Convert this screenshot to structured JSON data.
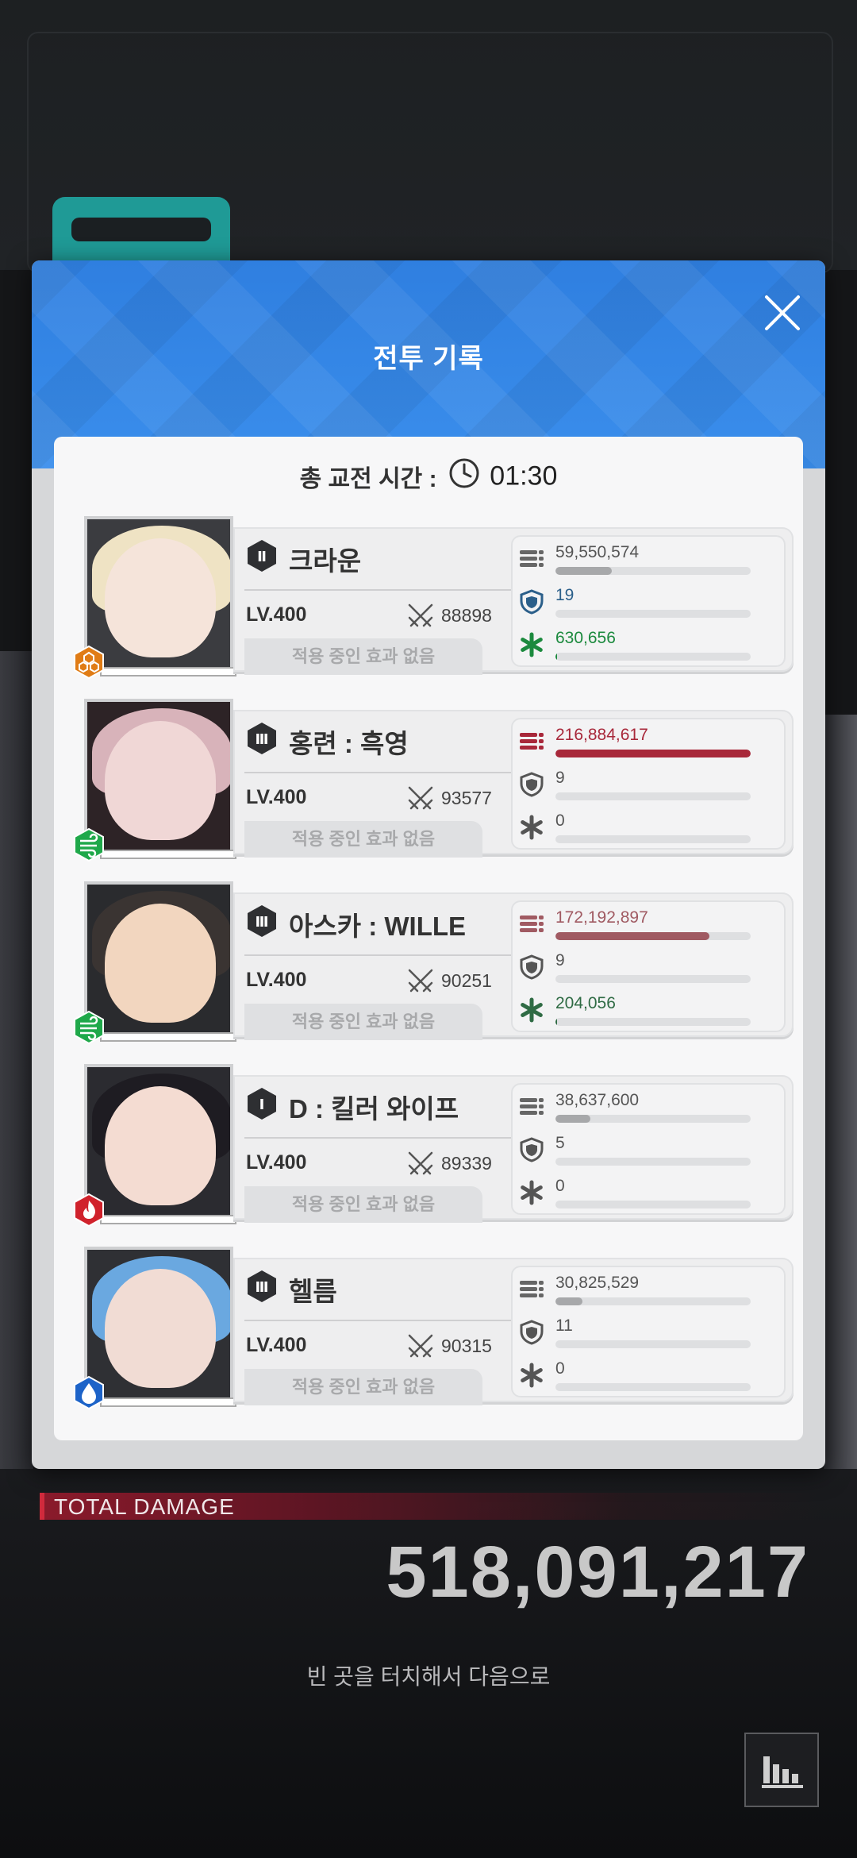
{
  "dialog": {
    "title": "전투 기록",
    "total_time_label": "총 교전 시간 :",
    "total_time": "01:30"
  },
  "characters": [
    {
      "rank": "Ⅱ",
      "name": "크라운",
      "level": "LV.400",
      "power": "88898",
      "effects": "적용 중인 효과 없음",
      "element": "honeycomb",
      "element_color": "#e07c16",
      "damage": "59,550,574",
      "damage_ratio": 0.29,
      "damage_color": "#a7a8aa",
      "shield": "19",
      "shield_ratio": 0.0,
      "shield_color": "#2b5f8a",
      "heal": "630,656",
      "heal_ratio": 0.01,
      "heal_color": "#1c8a3e"
    },
    {
      "rank": "Ⅲ",
      "name": "홍련 : 흑영",
      "level": "LV.400",
      "power": "93577",
      "effects": "적용 중인 효과 없음",
      "element": "wind",
      "element_color": "#1fa84a",
      "damage": "216,884,617",
      "damage_ratio": 1.0,
      "damage_color": "#a8283a",
      "shield": "9",
      "shield_ratio": 0.0,
      "shield_color": "#555555",
      "heal": "0",
      "heal_ratio": 0.0,
      "heal_color": "#555555"
    },
    {
      "rank": "Ⅲ",
      "name": "아스카 : WILLE",
      "level": "LV.400",
      "power": "90251",
      "effects": "적용 중인 효과 없음",
      "element": "wind",
      "element_color": "#1fa84a",
      "damage": "172,192,897",
      "damage_ratio": 0.79,
      "damage_color": "#a05a62",
      "shield": "9",
      "shield_ratio": 0.0,
      "shield_color": "#555555",
      "heal": "204,056",
      "heal_ratio": 0.0,
      "heal_color": "#2f6b44"
    },
    {
      "rank": "Ⅰ",
      "name": "D : 킬러 와이프",
      "level": "LV.400",
      "power": "89339",
      "effects": "적용 중인 효과 없음",
      "element": "fire",
      "element_color": "#d0222c",
      "damage": "38,637,600",
      "damage_ratio": 0.18,
      "damage_color": "#a7a8aa",
      "shield": "5",
      "shield_ratio": 0.0,
      "shield_color": "#555555",
      "heal": "0",
      "heal_ratio": 0.0,
      "heal_color": "#555555"
    },
    {
      "rank": "Ⅲ",
      "name": "헬름",
      "level": "LV.400",
      "power": "90315",
      "effects": "적용 중인 효과 없음",
      "element": "water",
      "element_color": "#1d63c8",
      "damage": "30,825,529",
      "damage_ratio": 0.14,
      "damage_color": "#a7a8aa",
      "shield": "11",
      "shield_ratio": 0.0,
      "shield_color": "#555555",
      "heal": "0",
      "heal_ratio": 0.0,
      "heal_color": "#555555"
    }
  ],
  "summary": {
    "total_damage_label": "TOTAL DAMAGE",
    "total_damage": "518,091,217",
    "hint": "빈 곳을 터치해서 다음으로"
  },
  "icons": {
    "close": "close-icon",
    "clock": "clock-icon",
    "damage": "bullets-icon",
    "shield": "shield-icon",
    "heal": "heal-cross-icon",
    "power": "crossed-swords-icon",
    "stats": "bar-chart-icon"
  }
}
